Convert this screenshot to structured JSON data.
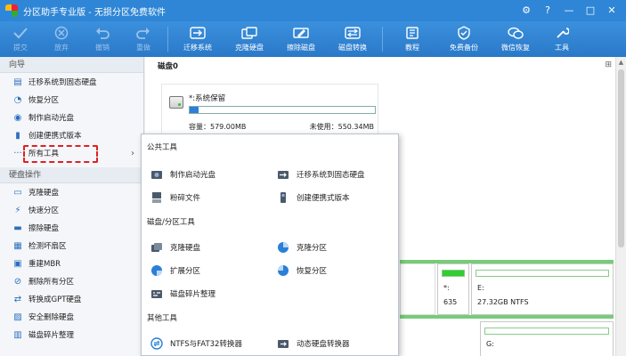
{
  "window": {
    "title": "分区助手专业版 - 无损分区免费软件"
  },
  "toolbar": {
    "buttons": [
      {
        "label": "提交",
        "icon": "check-icon",
        "disabled": true
      },
      {
        "label": "放弃",
        "icon": "discard-icon",
        "disabled": true
      },
      {
        "label": "撤销",
        "icon": "undo-icon",
        "disabled": true
      },
      {
        "label": "重做",
        "icon": "redo-icon",
        "disabled": true
      },
      {
        "label": "迁移系统",
        "icon": "migrate-icon",
        "disabled": false
      },
      {
        "label": "克隆硬盘",
        "icon": "clone-icon",
        "disabled": false
      },
      {
        "label": "擦除磁盘",
        "icon": "wipe-icon",
        "disabled": false
      },
      {
        "label": "磁盘转换",
        "icon": "convert-icon",
        "disabled": false
      },
      {
        "label": "教程",
        "icon": "tutorial-icon",
        "disabled": false
      },
      {
        "label": "免费备份",
        "icon": "backup-icon",
        "disabled": false
      },
      {
        "label": "微信恢复",
        "icon": "wechat-icon",
        "disabled": false
      },
      {
        "label": "工具",
        "icon": "tools-icon",
        "disabled": false
      }
    ]
  },
  "sidebar": {
    "wizard_title": "向导",
    "wizard_items": [
      {
        "label": "迁移系统到固态硬盘",
        "icon": "migrate-icon"
      },
      {
        "label": "恢复分区",
        "icon": "recover-icon"
      },
      {
        "label": "制作启动光盘",
        "icon": "disc-icon"
      },
      {
        "label": "创建便携式版本",
        "icon": "portable-icon"
      },
      {
        "label": "所有工具",
        "icon": "more-icon"
      }
    ],
    "disk_ops_title": "硬盘操作",
    "disk_items": [
      {
        "label": "克隆硬盘",
        "icon": "clone-icon"
      },
      {
        "label": "快速分区",
        "icon": "quick-partition-icon"
      },
      {
        "label": "擦除硬盘",
        "icon": "wipe-icon"
      },
      {
        "label": "检测坏扇区",
        "icon": "scan-icon"
      },
      {
        "label": "重建MBR",
        "icon": "rebuild-icon"
      },
      {
        "label": "删除所有分区",
        "icon": "delete-icon"
      },
      {
        "label": "转换成GPT硬盘",
        "icon": "convert-icon"
      },
      {
        "label": "安全删除硬盘",
        "icon": "secure-delete-icon"
      },
      {
        "label": "磁盘碎片整理",
        "icon": "defrag-icon"
      }
    ]
  },
  "main": {
    "disk_label": "磁盘0",
    "partition": {
      "name": "*:系统保留",
      "capacity": "容量：579.00MB",
      "free": "未使用：550.34MB",
      "used_fraction": 0.05
    },
    "disk_row2": [
      {
        "label": "*:",
        "sub": "635"
      },
      {
        "label": "E:",
        "sub": "27.32GB NTFS"
      }
    ],
    "disk_row3": {
      "label": "G:"
    }
  },
  "popup": {
    "section1_title": "公共工具",
    "section1_items": [
      {
        "label": "制作启动光盘",
        "icon": "disc-icon"
      },
      {
        "label": "迁移系统到固态硬盘",
        "icon": "migrate-icon"
      },
      {
        "label": "粉碎文件",
        "icon": "shred-icon"
      },
      {
        "label": "创建便携式版本",
        "icon": "portable-icon"
      }
    ],
    "section2_title": "磁盘/分区工具",
    "section2_items": [
      {
        "label": "克隆硬盘",
        "icon": "clone-icon"
      },
      {
        "label": "克隆分区",
        "icon": "clone-partition-icon"
      },
      {
        "label": "扩展分区",
        "icon": "extend-icon"
      },
      {
        "label": "恢复分区",
        "icon": "recover-icon"
      },
      {
        "label": "磁盘碎片整理",
        "icon": "defrag-icon"
      }
    ],
    "section3_title": "其他工具",
    "section3_items": [
      {
        "label": "NTFS与FAT32转换器",
        "icon": "ntfs-fat-icon"
      },
      {
        "label": "动态硬盘转换器",
        "icon": "dynamic-disk-icon"
      }
    ]
  },
  "colors": {
    "titlebar": "#2f86d6",
    "accent": "#2b7fd8",
    "highlight": "#dd2222"
  }
}
